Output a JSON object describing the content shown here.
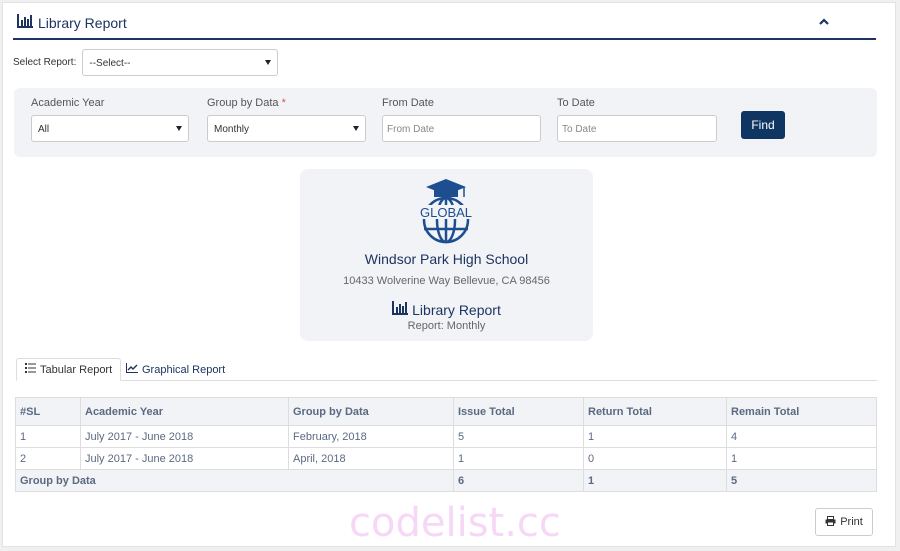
{
  "header": {
    "title": "Library Report",
    "icon": "bar-chart-icon",
    "collapse_icon": "chevron-up-icon"
  },
  "select_report": {
    "label": "Select Report:",
    "value": "--Select--"
  },
  "filters": {
    "academic_year": {
      "label": "Academic Year",
      "value": "All"
    },
    "group_by": {
      "label": "Group by Data",
      "required_mark": "*",
      "value": "Monthly"
    },
    "from_date": {
      "label": "From Date",
      "placeholder": "From Date"
    },
    "to_date": {
      "label": "To Date",
      "placeholder": "To Date"
    },
    "find_label": "Find"
  },
  "card": {
    "logo_text": "GLOBAL",
    "school_name": "Windsor Park High School",
    "address": "10433 Wolverine Way Bellevue, CA 98456",
    "report_title": "Library Report",
    "report_sub": "Report: Monthly"
  },
  "tabs": [
    {
      "label": "Tabular Report",
      "icon": "list-icon",
      "active": true
    },
    {
      "label": "Graphical Report",
      "icon": "line-chart-icon",
      "active": false
    }
  ],
  "table": {
    "headers": [
      "#SL",
      "Academic Year",
      "Group by Data",
      "Issue Total",
      "Return Total",
      "Remain Total"
    ],
    "rows": [
      [
        "1",
        "July 2017 - June 2018",
        "February, 2018",
        "5",
        "1",
        "4"
      ],
      [
        "2",
        "July 2017 - June 2018",
        "April, 2018",
        "1",
        "0",
        "1"
      ]
    ],
    "total": {
      "label": "Group by Data",
      "issue": "6",
      "return": "1",
      "remain": "5"
    }
  },
  "watermark": "codelist.cc",
  "print_label": "Print",
  "colors": {
    "primary": "#1d3461",
    "button": "#0f3663",
    "panel": "#f1f3f6"
  }
}
